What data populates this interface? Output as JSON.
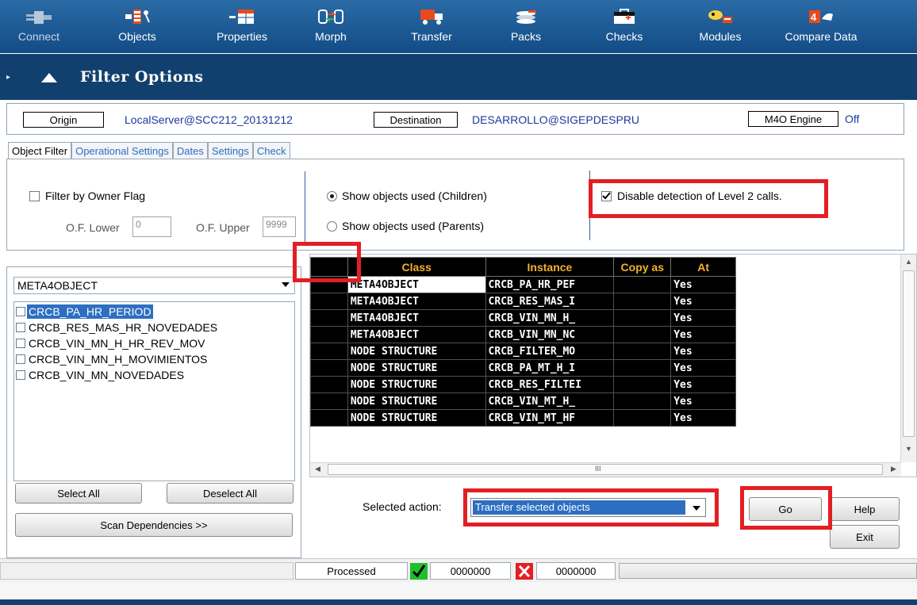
{
  "toolbar": {
    "items": [
      {
        "label": "Connect",
        "icon": "plug-icon"
      },
      {
        "label": "Objects",
        "icon": "objects-icon"
      },
      {
        "label": "Properties",
        "icon": "properties-icon"
      },
      {
        "label": "Morph",
        "icon": "morph-icon"
      },
      {
        "label": "Transfer",
        "icon": "truck-icon"
      },
      {
        "label": "Packs",
        "icon": "packs-icon"
      },
      {
        "label": "Checks",
        "icon": "first-aid-icon"
      },
      {
        "label": "Modules",
        "icon": "modules-icon"
      },
      {
        "label": "Compare Data",
        "icon": "compare-icon"
      }
    ]
  },
  "filter_header": {
    "title": "Filter Options"
  },
  "connection": {
    "origin_label": "Origin",
    "origin_value": "LocalServer@SCC212_20131212",
    "destination_label": "Destination",
    "destination_value": "DESARROLLO@SIGEPDESPRU",
    "engine_label": "M4O Engine",
    "engine_value": "Off"
  },
  "tabs": [
    "Object Filter",
    "Operational Settings",
    "Dates",
    "Settings",
    "Check"
  ],
  "object_filter": {
    "owner_flag_label": "Filter by Owner Flag",
    "of_lower_label": "O.F. Lower",
    "of_lower_value": "0",
    "of_upper_label": "O.F. Upper",
    "of_upper_value": "9999",
    "radio_children": "Show objects used (Children)",
    "radio_parents": "Show objects used (Parents)",
    "disable_level2": "Disable detection of Level 2 calls."
  },
  "left_panel": {
    "type_select": "META4OBJECT",
    "objects": [
      "CRCB_PA_HR_PERIOD",
      "CRCB_RES_MAS_HR_NOVEDADES",
      "CRCB_VIN_MN_H_HR_REV_MOV",
      "CRCB_VIN_MN_H_MOVIMIENTOS",
      "CRCB_VIN_MN_NOVEDADES"
    ],
    "select_all": "Select All",
    "deselect_all": "Deselect All",
    "scan_dependencies": "Scan Dependencies >>"
  },
  "grid": {
    "headers": [
      "Class",
      "Instance",
      "Copy as",
      "At"
    ],
    "rows": [
      [
        "META4OBJECT",
        "CRCB_PA_HR_PEF",
        "",
        "Yes"
      ],
      [
        "META4OBJECT",
        "CRCB_RES_MAS_I",
        "",
        "Yes"
      ],
      [
        "META4OBJECT",
        "CRCB_VIN_MN_H_",
        "",
        "Yes"
      ],
      [
        "META4OBJECT",
        "CRCB_VIN_MN_NC",
        "",
        "Yes"
      ],
      [
        "NODE STRUCTURE",
        "CRCB_FILTER_MO",
        "",
        "Yes"
      ],
      [
        "NODE STRUCTURE",
        "CRCB_PA_MT_H_I",
        "",
        "Yes"
      ],
      [
        "NODE STRUCTURE",
        "CRCB_RES_FILTEI",
        "",
        "Yes"
      ],
      [
        "NODE STRUCTURE",
        "CRCB_VIN_MT_H_",
        "",
        "Yes"
      ],
      [
        "NODE STRUCTURE",
        "CRCB_VIN_MT_HF",
        "",
        "Yes"
      ]
    ]
  },
  "actions": {
    "selected_action_label": "Selected action:",
    "selected_action_value": "Transfer selected objects",
    "go": "Go",
    "help": "Help",
    "exit": "Exit"
  },
  "status": {
    "processed_label": "Processed",
    "ok_count": "0000000",
    "error_count": "0000000",
    "scroll_marker": "III"
  },
  "colors": {
    "highlight_red": "#e31e24",
    "toolbar_blue": "#1a5a96",
    "header_blue": "#12406e"
  }
}
